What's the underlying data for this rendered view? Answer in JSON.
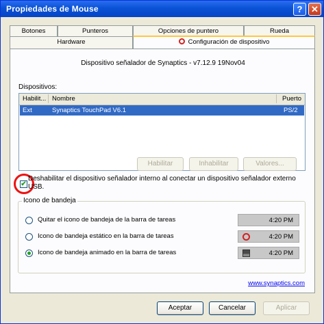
{
  "window": {
    "title": "Propiedades de Mouse",
    "help_label": "?",
    "close_label": "✕"
  },
  "tabs_row1": [
    "Botones",
    "Punteros",
    "Opciones de puntero",
    "Rueda"
  ],
  "tabs_row2": [
    {
      "label": "Hardware"
    },
    {
      "label": "Configuración de dispositivo",
      "active": true,
      "icon": "synaptics-icon"
    }
  ],
  "panel": {
    "info": "Dispositivo señalador de Synaptics - v7.12.9 19Nov04",
    "devices_label": "Dispositivos:",
    "list_headers": [
      "Habilit...",
      "Nombre",
      "Puerto"
    ],
    "list_rows": [
      {
        "enabled": "Ext",
        "name": "Synaptics TouchPad V6.1",
        "port": "PS/2"
      }
    ],
    "buttons": [
      "Habilitar",
      "Inhabilitar",
      "Valores..."
    ],
    "checkbox_label": "Deshabilitar el dispositivo señalador interno al conectar un dispositivo señalador externo USB.",
    "checkbox_checked": true,
    "tray_group_label": "Icono de bandeja",
    "tray_options": [
      {
        "label": "Quitar el icono de bandeja de la barra de tareas",
        "time": "4:20 PM",
        "selected": false,
        "icon": ""
      },
      {
        "label": "Icono de bandeja estático en la barra de tareas",
        "time": "4:20 PM",
        "selected": false,
        "icon": "synaptics-static-icon"
      },
      {
        "label": "Icono de bandeja animado en la barra de tareas",
        "time": "4:20 PM",
        "selected": true,
        "icon": "synaptics-animated-icon"
      }
    ],
    "link": "www.synaptics.com"
  },
  "footer": {
    "accept": "Aceptar",
    "cancel": "Cancelar",
    "apply": "Aplicar"
  },
  "colors": {
    "title_bar": "#0a52d6",
    "selection": "#316ac5",
    "highlight_circle": "#e11111"
  }
}
